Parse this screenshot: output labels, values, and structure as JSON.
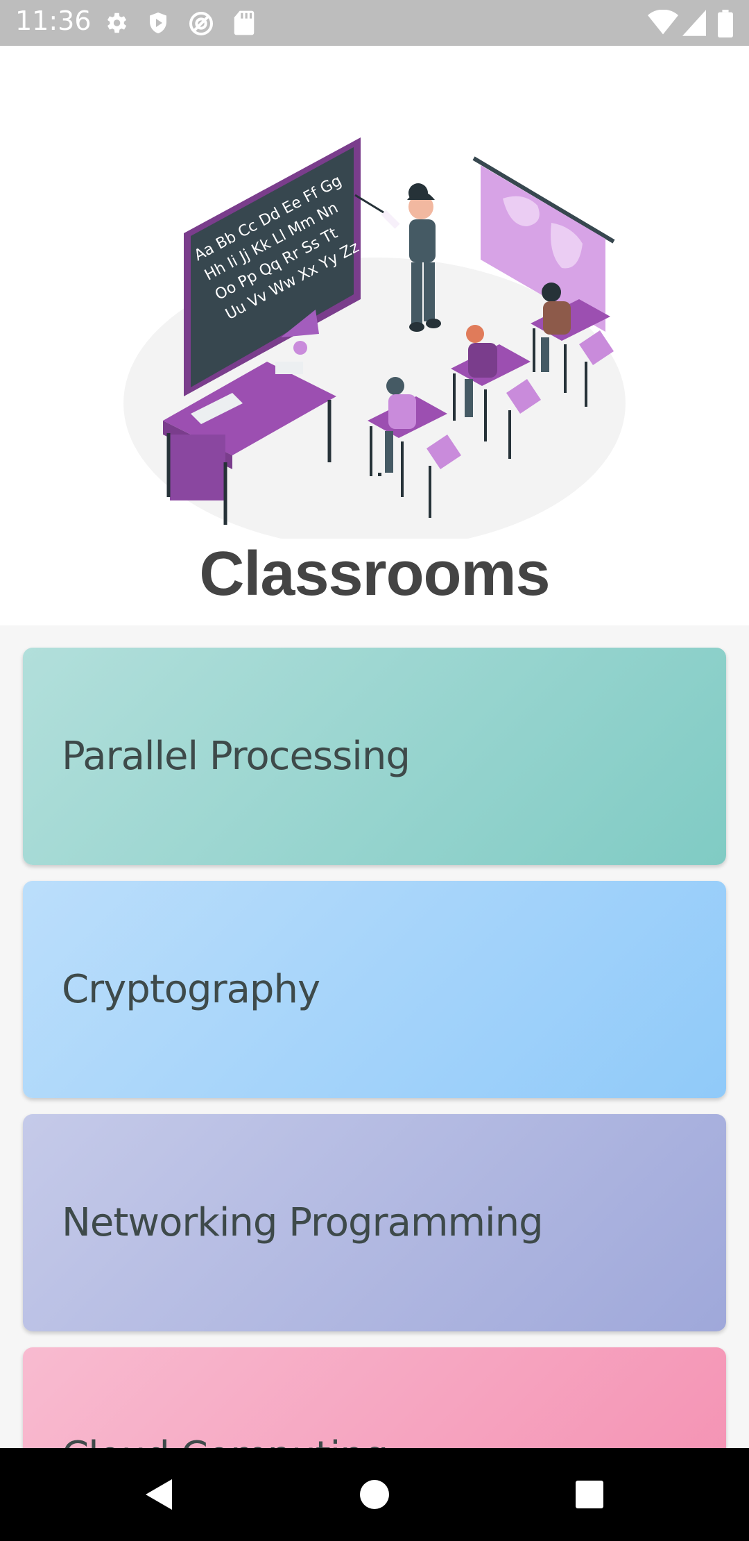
{
  "status_bar": {
    "time": "11:36",
    "left_icons": [
      "gear-icon",
      "shield-icon",
      "vpn-key-icon",
      "sd-card-icon"
    ],
    "right_icons": [
      "wifi-icon",
      "signal-icon",
      "battery-icon"
    ]
  },
  "header": {
    "illustration": "classroom-illustration",
    "title": "Classrooms",
    "chalkboard_text": [
      "Aa Bb Cc Dd Ee Ff Gg",
      "Hh Ii Jj Kk Ll Mm Nn",
      "Oo Pp Qq Rr Ss Tt",
      "Uu Vv Ww Xx Yy Zz"
    ]
  },
  "classrooms": [
    {
      "name": "Parallel Processing",
      "color_start": "#b2dfdb",
      "color_end": "#80cbc4"
    },
    {
      "name": "Cryptography",
      "color_start": "#bbdefb",
      "color_end": "#90caf9"
    },
    {
      "name": "Networking Programming",
      "color_start": "#c5cae9",
      "color_end": "#9fa8da"
    },
    {
      "name": "Cloud Computing",
      "color_start": "#f8bbd0",
      "color_end": "#f48fb1"
    }
  ],
  "nav_bar": {
    "back": "back-icon",
    "home": "home-icon",
    "recents": "recents-icon"
  },
  "colors": {
    "status_bar": "#bdbdbd",
    "title_text": "#444444",
    "card_text": "#3e4a4a",
    "accent_purple": "#9c4fb1"
  }
}
